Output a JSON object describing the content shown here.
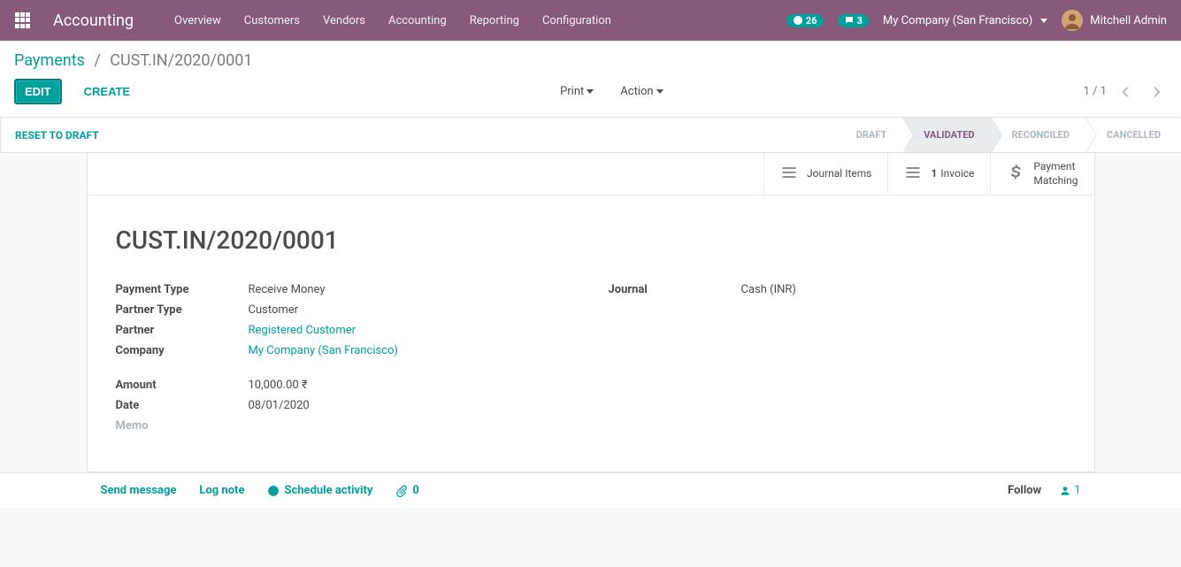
{
  "nav": {
    "brand": "Accounting",
    "menu": [
      "Overview",
      "Customers",
      "Vendors",
      "Accounting",
      "Reporting",
      "Configuration"
    ],
    "badge_timer": "26",
    "badge_discuss": "3",
    "company": "My Company (San Francisco)",
    "user": "Mitchell Admin"
  },
  "breadcrumb": {
    "root": "Payments",
    "current": "CUST.IN/2020/0001"
  },
  "toolbar": {
    "edit": "EDIT",
    "create": "CREATE",
    "print": "Print",
    "action": "Action",
    "pager": "1 / 1"
  },
  "status": {
    "reset": "RESET TO DRAFT",
    "steps": {
      "draft": "DRAFT",
      "validated": "VALIDATED",
      "reconciled": "RECONCILED",
      "cancelled": "CANCELLED"
    }
  },
  "buttons": {
    "journal": "Journal Items",
    "invoice_count": "1",
    "invoice_label": "Invoice",
    "matching_l1": "Payment",
    "matching_l2": "Matching"
  },
  "record": {
    "title": "CUST.IN/2020/0001",
    "labels": {
      "payment_type": "Payment Type",
      "partner_type": "Partner Type",
      "partner": "Partner",
      "company": "Company",
      "amount": "Amount",
      "date": "Date",
      "memo": "Memo",
      "journal": "Journal"
    },
    "values": {
      "payment_type": "Receive Money",
      "partner_type": "Customer",
      "partner": "Registered Customer",
      "company": "My Company (San Francisco)",
      "amount": "10,000.00 ₹",
      "date": "08/01/2020",
      "journal": "Cash (INR)"
    }
  },
  "chatter": {
    "send": "Send message",
    "log": "Log note",
    "schedule": "Schedule activity",
    "attach_count": "0",
    "follow": "Follow",
    "followers": "1"
  }
}
